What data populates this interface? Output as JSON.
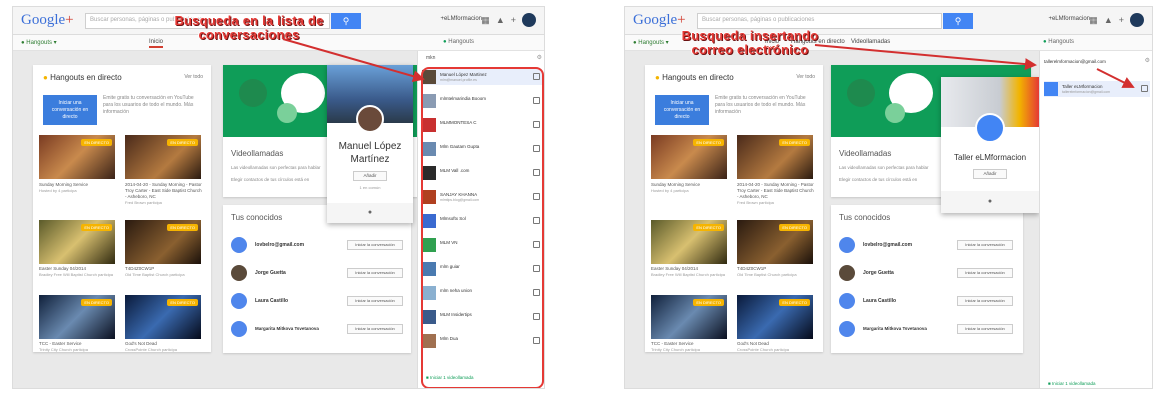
{
  "left": {
    "logo": {
      "main": "Google",
      "plus": "+"
    },
    "search_placeholder": "Buscar personas, páginas o publicaciones",
    "account": "+eLMformacion",
    "subnav": {
      "hangouts": "Hangouts",
      "tab_inicio": "Inicio",
      "panel_title": "Hangouts"
    },
    "live": {
      "title_prefix": "Hangouts en directo",
      "see_all": "Ver todo",
      "start_button": "Iniciar una conversación en directo",
      "description": "Emite gratis tu conversación en YouTube para los usuarios de todo el mundo. Más información",
      "videos": [
        {
          "badge": "EN DIRECTO",
          "title": "Sunday Morning Service",
          "by": "Hosted by 4 participa"
        },
        {
          "badge": "EN DIRECTO",
          "title": "2014-04-20 - Sunday Morning - Pastor Troy Carter - East Side Baptist Church - Asheboro, NC",
          "by": "Fred Brown participa"
        },
        {
          "badge": "EN DIRECTO",
          "title": "Easter Sunday 04/2014",
          "by": "Bradley Free Will Baptist Church participa"
        },
        {
          "badge": "EN DIRECTO",
          "title": "T4D4Z0CW1P",
          "by": "Old Time Baptist Church participa"
        },
        {
          "badge": "EN DIRECTO",
          "title": "TCC - Easter Service",
          "by": "Trinity City Church participa"
        },
        {
          "badge": "EN DIRECTO",
          "title": "God's Not Dead",
          "by": "CrossPointe Church participa"
        }
      ]
    },
    "video": {
      "heading": "Videollamadas",
      "line1": "Las videollamadas son perfectas para hablar",
      "line2": "Elegir contactos de tus círculos está en"
    },
    "known": {
      "heading": "Tus conocidos",
      "contacts": [
        {
          "name": "lovbelro@gmail.com",
          "button": "Iniciar la conversación"
        },
        {
          "name": "Jorge Guetta",
          "button": "Iniciar la conversación"
        },
        {
          "name": "Laura Castillo",
          "button": "Iniciar la conversación"
        },
        {
          "name": "Margarita Mitkova Tsvetanova",
          "button": "Iniciar la conversación"
        }
      ]
    },
    "popup": {
      "name_line1": "Manuel López",
      "name_line2": "Martínez",
      "add_button": "Añadir",
      "sub": "1 en común"
    },
    "panel": {
      "search_value": "mkn",
      "rows": [
        {
          "name": "Manuel López Martinez",
          "sub": "mlm@manuel.profile.es"
        },
        {
          "name": "mlmtelmarindia Booom",
          "sub": ""
        },
        {
          "name": "MLMMONTESA C",
          "sub": ""
        },
        {
          "name": "Mlm Gautam Gupta",
          "sub": ""
        },
        {
          "name": "MLM Vall .com",
          "sub": ""
        },
        {
          "name": "SANJAY KHANNA",
          "sub": "mlmtips.blog@gmail.com"
        },
        {
          "name": "Mlmsoftx Sol",
          "sub": ""
        },
        {
          "name": "MLM VN",
          "sub": ""
        },
        {
          "name": "mlm guiar",
          "sub": ""
        },
        {
          "name": "mlm neha union",
          "sub": ""
        },
        {
          "name": "MLM Insidertips",
          "sub": ""
        },
        {
          "name": "Mlm Dua",
          "sub": ""
        }
      ],
      "video_call": "Iniciar 1 videollamada"
    },
    "annotation": {
      "line1": "Busqueda en la lista de",
      "line2": "conversaciones"
    }
  },
  "right": {
    "logo": {
      "main": "Google",
      "plus": "+"
    },
    "search_placeholder": "Buscar personas, páginas o publicaciones",
    "account": "+eLMformacion",
    "subnav": {
      "hangouts": "Hangouts",
      "tab_inicio": "Inicio",
      "tab_hangouts": "Hangouts en directo",
      "tab_video": "Videollamadas",
      "panel_title": "Hangouts"
    },
    "live": {
      "title_prefix": "Hangouts en directo",
      "see_all": "Ver todo",
      "start_button": "Iniciar una conversación en directo",
      "description": "Emite gratis tu conversación en YouTube para los usuarios de todo el mundo. Más información",
      "videos": [
        {
          "badge": "EN DIRECTO",
          "title": "Sunday Morning Service",
          "by": "Hosted by 4 participa"
        },
        {
          "badge": "EN DIRECTO",
          "title": "2014-04-20 - Sunday Morning - Pastor Troy Carter - East Side Baptist Church - Asheboro, NC",
          "by": "Fred Brown participa"
        },
        {
          "badge": "EN DIRECTO",
          "title": "Easter Sunday 04/2014",
          "by": "Bradley Free Will Baptist Church participa"
        },
        {
          "badge": "EN DIRECTO",
          "title": "T4D4Z0CW1P",
          "by": "Old Time Baptist Church participa"
        },
        {
          "badge": "EN DIRECTO",
          "title": "TCC - Easter Service",
          "by": "Trinity City Church participa"
        },
        {
          "badge": "EN DIRECTO",
          "title": "God's Not Dead",
          "by": "CrossPointe Church participa"
        }
      ]
    },
    "video": {
      "heading": "Videollamadas",
      "line1": "Las videollamadas son perfectas para hablar",
      "line2": "Elegir contactos de tus círculos está en"
    },
    "known": {
      "heading": "Tus conocidos",
      "contacts": [
        {
          "name": "lovbelro@gmail.com",
          "button": "Iniciar la conversación"
        },
        {
          "name": "Jorge Guetta",
          "button": "Iniciar la conversación"
        },
        {
          "name": "Laura Castillo",
          "button": "Iniciar la conversación"
        },
        {
          "name": "Margarita Mitkova Tsvetanova",
          "button": "Iniciar la conversación"
        }
      ]
    },
    "popup": {
      "name": "Taller eLMformacion",
      "add_button": "Añadir"
    },
    "panel": {
      "search_value": "tallerelmformacion@gmail.com",
      "rows": [
        {
          "name": "Taller eLMformacion",
          "sub": "tallerelmformacion@gmail.com"
        }
      ],
      "video_call": "Iniciar 1 videollamada"
    },
    "annotation": {
      "line1": "Busqueda insertando",
      "line2": "correo electrónico"
    }
  },
  "colors": {
    "accent": "#4285f4",
    "hangouts_green": "#0f9d58",
    "annotation_red": "#e53935",
    "live_yellow": "#f6b400"
  }
}
